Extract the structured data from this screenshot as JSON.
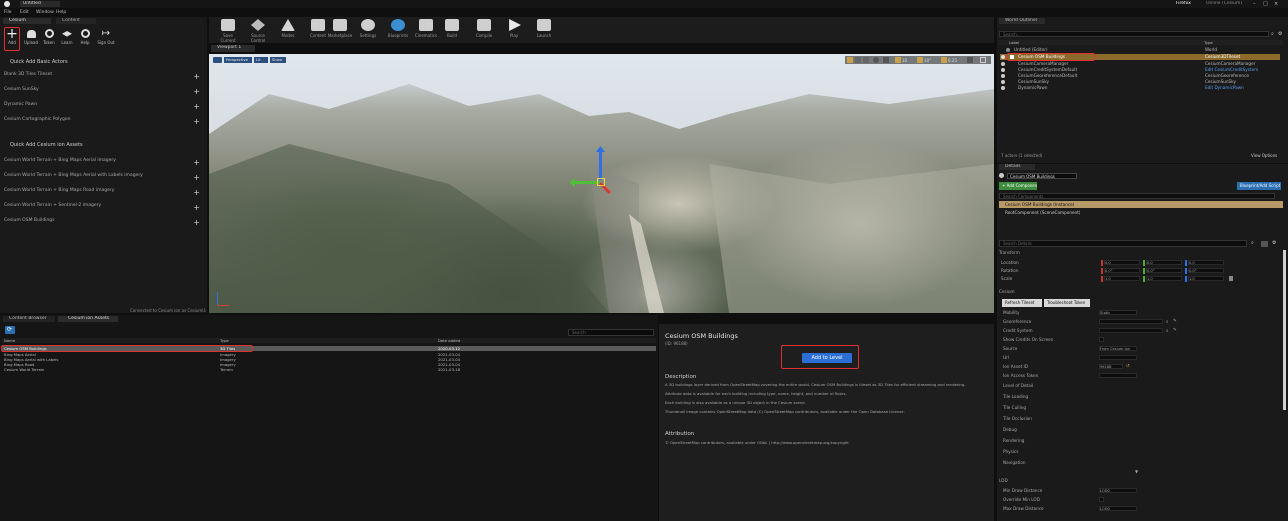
{
  "titlebar": {
    "tab": "Untitled",
    "user": "Firefox",
    "status": "Online (Cesium)"
  },
  "menu": [
    "File",
    "Edit",
    "Window",
    "Help"
  ],
  "left_panel": {
    "tabs": [
      "Cesium",
      "Content"
    ],
    "toolbar": [
      "Add",
      "Upload",
      "Token",
      "Learn",
      "Help",
      "Sign Out"
    ],
    "section1": "Quick Add Basic Actors",
    "basic_items": [
      "Blank 3D Tiles Tileset",
      "Cesium SunSky",
      "Dynamic Pawn",
      "Cesium Cartographic Polygon"
    ],
    "section2": "Quick Add Cesium ion Assets",
    "ion_items": [
      "Cesium World Terrain + Bing Maps Aerial imagery",
      "Cesium World Terrain + Bing Maps Aerial with Labels imagery",
      "Cesium World Terrain + Bing Maps Road imagery",
      "Cesium World Terrain + Sentinel-2 imagery",
      "Cesium OSM Buildings"
    ],
    "footer": "Connected to Cesium ion as CesiumUser"
  },
  "toolbar": {
    "buttons": [
      "Save Current",
      "Source Control",
      "Modes",
      "Content",
      "Marketplace",
      "Settings",
      "Blueprints",
      "Cinematics",
      "Build",
      "Compile",
      "Play",
      "Launch"
    ]
  },
  "viewport": {
    "tab": "Viewport 1",
    "view_buttons": [
      "Perspective",
      "Lit",
      "Show"
    ],
    "snap_value": "10",
    "rotate_value": "10°",
    "scale_value": "0.25"
  },
  "outliner": {
    "tab": "World Outliner",
    "search_placeholder": "Search...",
    "columns": [
      "Label",
      "Type"
    ],
    "rows": [
      {
        "label": "Untitled (Editor)",
        "type": "World",
        "selected": false
      },
      {
        "label": "Cesium OSM Buildings",
        "type": "Cesium3DTileset",
        "selected": true
      },
      {
        "label": "CesiumCameraManager",
        "type": "CesiumCameraManager",
        "selected": false
      },
      {
        "label": "CesiumCreditSystemDefault",
        "type": "Edit CesiumCreditSystem",
        "selected": false
      },
      {
        "label": "CesiumGeoreferenceDefault",
        "type": "CesiumGeoreference",
        "selected": false
      },
      {
        "label": "CesiumSunSky",
        "type": "CesiumSunSky",
        "selected": false
      },
      {
        "label": "DynamicPawn",
        "type": "Edit DynamicPawn",
        "selected": false
      }
    ],
    "footer": "7 actors (1 selected)",
    "view_options": "View Options"
  },
  "details": {
    "tab": "Details",
    "actor_name": "Cesium OSM Buildings",
    "add_component": "+ Add Component",
    "blueprint_button": "Blueprint/Add Script",
    "search_placeholder": "Search Components",
    "component_root": "Cesium OSM Buildings (Instance)",
    "component_child": "RootComponent (SceneComponent)",
    "props_search": "Search Details",
    "transform_label": "Transform",
    "location_label": "Location",
    "rotation_label": "Rotation",
    "scale_label": "Scale",
    "location": [
      "0.0",
      "0.0",
      "0.0"
    ],
    "rotation": [
      "0.0°",
      "0.0°",
      "0.0°"
    ],
    "scale": [
      "1.0",
      "1.0",
      "1.0"
    ],
    "cesium_label": "Cesium",
    "cesium_buttons": [
      "Refresh Tileset",
      "Troubleshoot Token"
    ],
    "props": [
      {
        "label": "Mobility",
        "value": "Static"
      },
      {
        "label": "Georeference",
        "value": ""
      },
      {
        "label": "Credit System",
        "value": ""
      },
      {
        "label": "Show Credits On Screen",
        "value": ""
      },
      {
        "label": "Source",
        "value": "From Cesium Ion"
      },
      {
        "label": "Url",
        "value": ""
      },
      {
        "label": "Ion Asset ID",
        "value": "96188"
      },
      {
        "label": "Ion Access Token",
        "value": ""
      }
    ],
    "collapsed": [
      "Level of Detail",
      "Tile Loading",
      "Tile Culling",
      "Tile Occlusion",
      "Debug",
      "Rendering",
      "Physics",
      "Navigation"
    ],
    "lod_label": "LOD",
    "lod_rows": [
      {
        "label": "Min Draw Distance",
        "value": "LOD0"
      },
      {
        "label": "Override Min LOD",
        "value": ""
      },
      {
        "label": "Max Draw Distance",
        "value": "LOD0"
      }
    ]
  },
  "content_browser": {
    "tabs": [
      "Content Browser",
      "Cesium ion Assets"
    ],
    "search_placeholder": "Search",
    "columns": [
      "Name",
      "Type",
      "Date added"
    ],
    "rows": [
      {
        "name": "Cesium OSM Buildings",
        "type": "3D Tiles",
        "date": "2020-03-12",
        "selected": true
      },
      {
        "name": "Bing Maps Aerial",
        "type": "Imagery",
        "date": "2021-03-04"
      },
      {
        "name": "Bing Maps Aerial with Labels",
        "type": "Imagery",
        "date": "2021-03-04"
      },
      {
        "name": "Bing Maps Road",
        "type": "Imagery",
        "date": "2021-03-04"
      },
      {
        "name": "Cesium World Terrain",
        "type": "Terrain",
        "date": "2021-03-18"
      }
    ]
  },
  "asset_info": {
    "title": "Cesium OSM Buildings",
    "subtitle": "(ID: 96188)",
    "add_button": "Add to Level",
    "description_header": "Description",
    "description": [
      "A 3D buildings layer derived from OpenStreetMap covering the entire world. Cesium OSM Buildings is tileset as 3D Tiles for efficient streaming and rendering.",
      "Attribute data is available for each building including type, name, height, and number of floors.",
      "Each building is also available as a unique 3D object in the Cesium scene.",
      "Thumbnail image contains OpenStreetMap data (C) OpenStreetMap contributors, available under the Open Database License."
    ],
    "attribution_header": "Attribution",
    "attribution": "© OpenStreetMap contributors, available under ODbL | http://www.openstreetmap.org/copyright"
  }
}
